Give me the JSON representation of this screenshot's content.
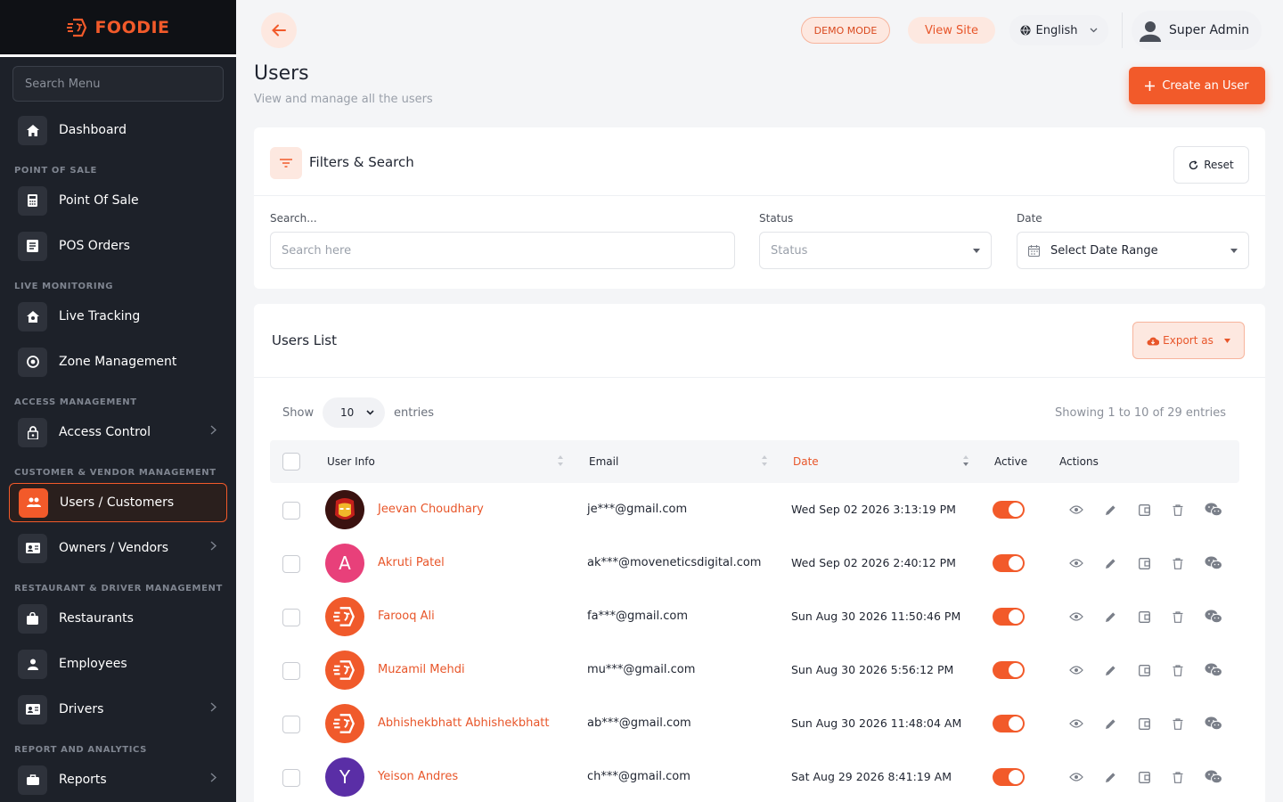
{
  "brand": {
    "name": "FOODIE",
    "color": "#f25a2a"
  },
  "sidebar": {
    "search_placeholder": "Search Menu",
    "dashboard": "Dashboard",
    "sections": {
      "pos": "POINT OF SALE",
      "live": "LIVE MONITORING",
      "access": "ACCESS MANAGEMENT",
      "cust": "CUSTOMER & VENDOR MANAGEMENT",
      "rest": "RESTAURANT & DRIVER MANAGEMENT",
      "report": "REPORT AND ANALYTICS"
    },
    "items": {
      "pos": "Point Of Sale",
      "pos_orders": "POS Orders",
      "live_tracking": "Live Tracking",
      "zone": "Zone Management",
      "access_control": "Access Control",
      "users": "Users / Customers",
      "owners": "Owners / Vendors",
      "restaurants": "Restaurants",
      "employees": "Employees",
      "drivers": "Drivers",
      "reports": "Reports"
    }
  },
  "topbar": {
    "demo": "DEMO MODE",
    "view_site": "View Site",
    "language": "English",
    "admin": "Super Admin"
  },
  "header": {
    "title": "Users",
    "subtitle": "View and manage all the users",
    "create_label": "Create an User"
  },
  "filters": {
    "title": "Filters & Search",
    "reset": "Reset",
    "search_label": "Search...",
    "search_placeholder": "Search here",
    "status_label": "Status",
    "status_placeholder": "Status",
    "date_label": "Date",
    "date_placeholder": "Select Date Range"
  },
  "list": {
    "title": "Users List",
    "export": "Export as",
    "show": "Show",
    "entries_value": "10",
    "entries": "entries",
    "showing": "Showing 1 to 10 of 29 entries",
    "columns": {
      "user_info": "User Info",
      "email": "Email",
      "date": "Date",
      "active": "Active",
      "actions": "Actions"
    },
    "rows": [
      {
        "name": "Jeevan Choudhary",
        "email": "je***@gmail.com",
        "date": "Wed Sep 02 2026 3:13:19 PM",
        "avatar": "ironman-avatar",
        "active": true
      },
      {
        "name": "Akruti Patel",
        "email": "ak***@moveneticsdigital.com",
        "date": "Wed Sep 02 2026 2:40:12 PM",
        "avatar_letter": "A",
        "avatar_color": "#e8407a",
        "active": true
      },
      {
        "name": "Farooq Ali",
        "email": "fa***@gmail.com",
        "date": "Sun Aug 30 2026 11:50:46 PM",
        "avatar": "brand-logo-icon",
        "active": true
      },
      {
        "name": "Muzamil Mehdi",
        "email": "mu***@gmail.com",
        "date": "Sun Aug 30 2026 5:56:12 PM",
        "avatar": "brand-logo-icon",
        "active": true
      },
      {
        "name": "Abhishekbhatt Abhishekbhatt",
        "email": "ab***@gmail.com",
        "date": "Sun Aug 30 2026 11:48:04 AM",
        "avatar": "brand-logo-icon",
        "active": true
      },
      {
        "name": "Yeison Andres",
        "email": "ch***@gmail.com",
        "date": "Sat Aug 29 2026 8:41:19 AM",
        "avatar_letter": "Y",
        "avatar_color": "#5a2ea6",
        "active": true
      }
    ]
  }
}
